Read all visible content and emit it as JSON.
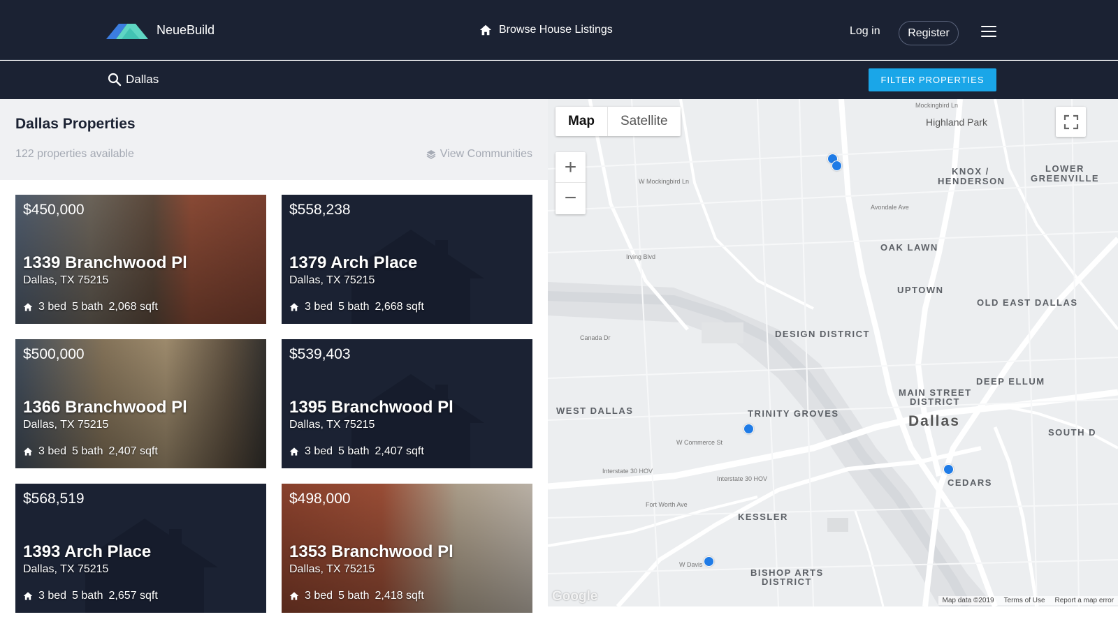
{
  "brand": {
    "name": "NeueBuild",
    "logo_icon": "neuebuild-logo-icon"
  },
  "nav": {
    "browse_label": "Browse House Listings",
    "login_label": "Log in",
    "register_label": "Register",
    "menu_icon": "hamburger-menu-icon"
  },
  "search": {
    "value": "Dallas",
    "filter_label": "FILTER PROPERTIES",
    "accent": "#1aa6e8"
  },
  "panel": {
    "title": "Dallas Properties",
    "count": "122 properties available",
    "view_communities": "View Communities"
  },
  "listings": [
    {
      "price": "$450,000",
      "address": "1339 Branchwood Pl",
      "city": "Dallas, TX 75215",
      "beds": "3 bed",
      "baths": "5 bath",
      "sqft": "2,068 sqft",
      "photo": true
    },
    {
      "price": "$558,238",
      "address": "1379 Arch Place",
      "city": "Dallas, TX 75215",
      "beds": "3 bed",
      "baths": "5 bath",
      "sqft": "2,668 sqft",
      "photo": false
    },
    {
      "price": "$500,000",
      "address": "1366 Branchwood Pl",
      "city": "Dallas, TX 75215",
      "beds": "3 bed",
      "baths": "5 bath",
      "sqft": "2,407 sqft",
      "photo": true
    },
    {
      "price": "$539,403",
      "address": "1395 Branchwood Pl",
      "city": "Dallas, TX 75215",
      "beds": "3 bed",
      "baths": "5 bath",
      "sqft": "2,407 sqft",
      "photo": false
    },
    {
      "price": "$568,519",
      "address": "1393 Arch Place",
      "city": "Dallas, TX 75215",
      "beds": "3 bed",
      "baths": "5 bath",
      "sqft": "2,657 sqft",
      "photo": false
    },
    {
      "price": "$498,000",
      "address": "1353 Branchwood Pl",
      "city": "Dallas, TX 75215",
      "beds": "3 bed",
      "baths": "5 bath",
      "sqft": "2,418 sqft",
      "photo": true
    }
  ],
  "map": {
    "type_map": "Map",
    "type_satellite": "Satellite",
    "zoom_in": "+",
    "zoom_out": "−",
    "google": "Google",
    "attribution": "Map data ©2019",
    "terms": "Terms of Use",
    "report": "Report a map error",
    "pin_color": "#1f7be6",
    "labels": {
      "highland_park": "Highland Park",
      "knox": "KNOX /",
      "henderson": "HENDERSON",
      "lower": "LOWER",
      "greenville": "GREENVILLE",
      "oak_lawn": "OAK LAWN",
      "uptown": "UPTOWN",
      "old_east_dallas": "OLD EAST DALLAS",
      "design_district": "DESIGN DISTRICT",
      "deep_ellum": "DEEP ELLUM",
      "main_street": "MAIN STREET",
      "district": "DISTRICT",
      "dallas": "Dallas",
      "west_dallas": "WEST DALLAS",
      "trinity_groves": "TRINITY GROVES",
      "south_d": "SOUTH D",
      "cedars": "CEDARS",
      "kessler": "KESSLER",
      "bishop_arts": "BISHOP ARTS",
      "bishop_district": "DISTRICT",
      "mockingbird_ln": "Mockingbird Ln",
      "w_mockingbird_ln": "W Mockingbird Ln",
      "irving_blvd": "Irving Blvd",
      "canada_dr": "Canada Dr",
      "w_commerce_st": "W Commerce St",
      "interstate_30_hov": "Interstate 30 HOV",
      "interstate_30_hov_2": "Interstate 30 HOV",
      "w_davis": "W Davis",
      "fort_worth_ave": "Fort Worth Ave",
      "avondale_ave": "Avondale Ave"
    }
  }
}
